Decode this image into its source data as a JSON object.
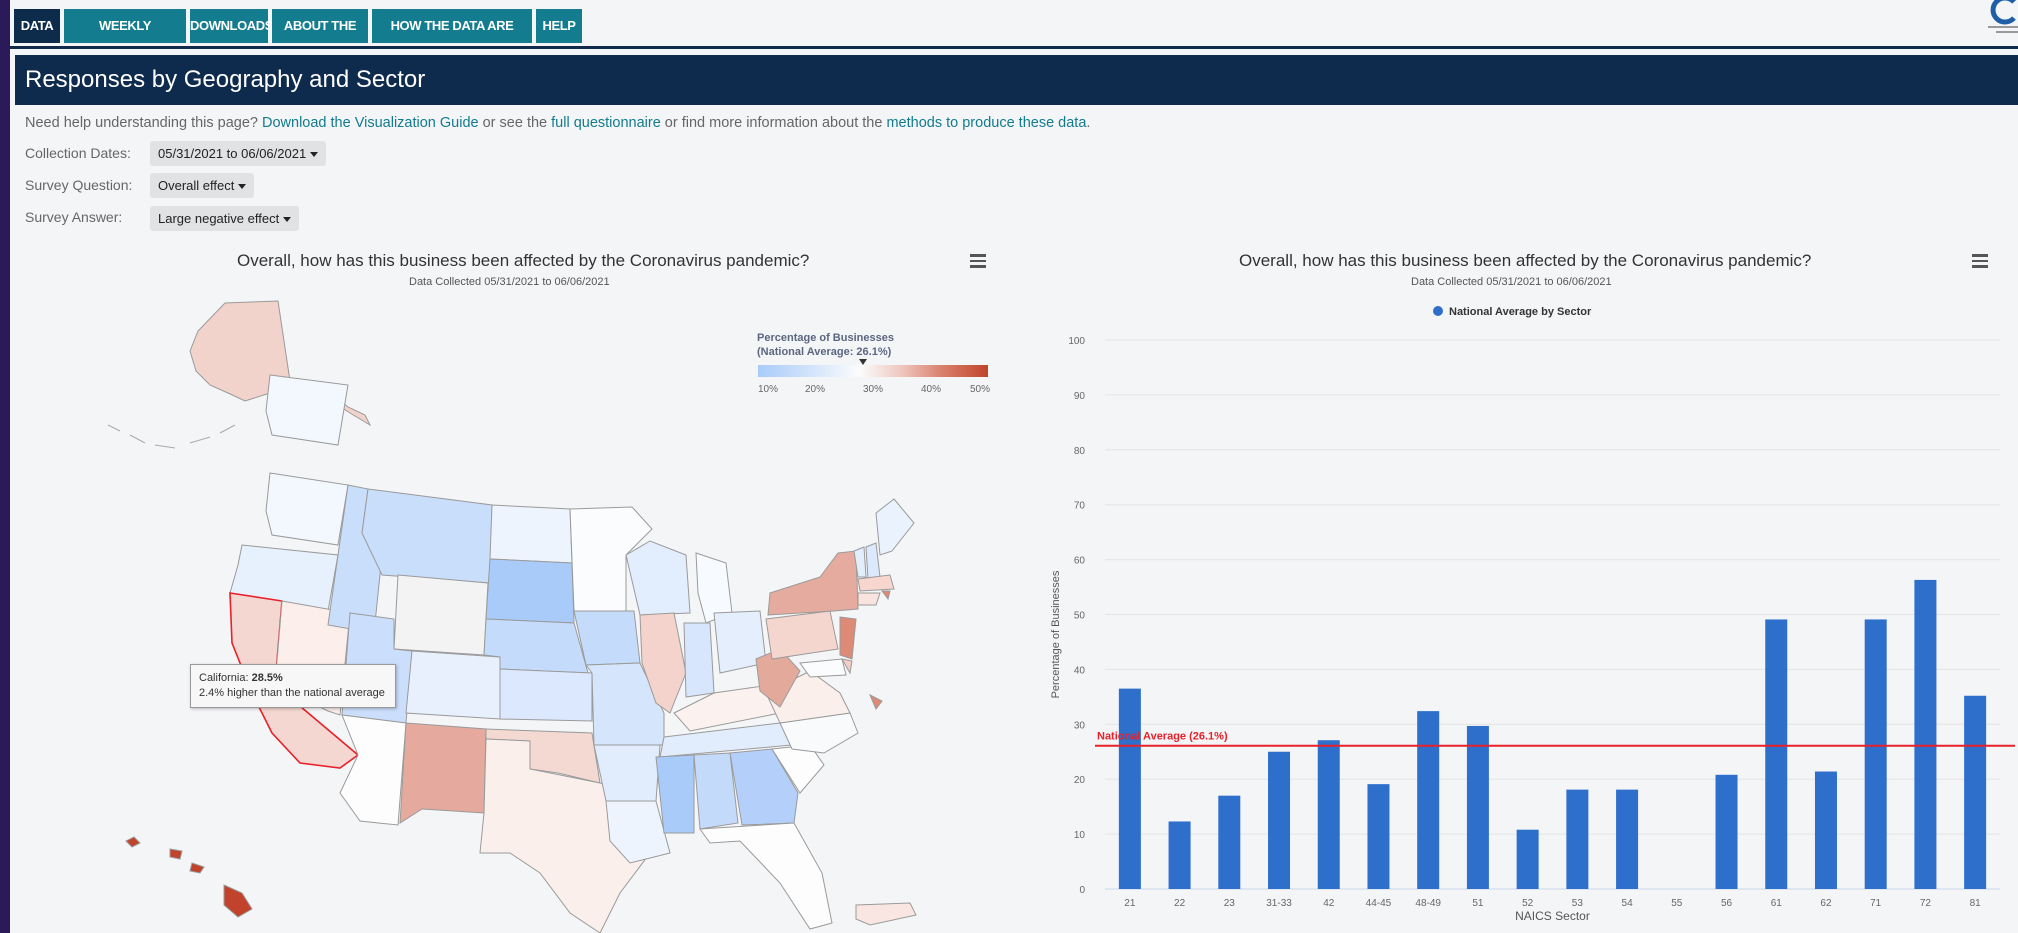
{
  "nav": {
    "tabs": [
      {
        "label": "DATA",
        "active": true
      },
      {
        "label": "WEEKLY COMPARISONS",
        "active": false
      },
      {
        "label": "DOWNLOADS",
        "active": false
      },
      {
        "label": "ABOUT THE DATA",
        "active": false
      },
      {
        "label": "HOW THE DATA ARE COLLECTED",
        "active": false
      },
      {
        "label": "HELP",
        "active": false
      }
    ]
  },
  "header": {
    "title": "Responses by Geography and Sector"
  },
  "help": {
    "t1": "Need help understanding this page? ",
    "l1": "Download the Visualization Guide",
    "t2": " or see the ",
    "l2": "full questionnaire",
    "t3": " or find more information about the ",
    "l3": "methods to produce these data",
    "t4": "."
  },
  "filters": {
    "dates_label": "Collection Dates:",
    "dates_value": "05/31/2021 to 06/06/2021",
    "question_label": "Survey Question:",
    "question_value": "Overall effect",
    "answer_label": "Survey Answer:",
    "answer_value": "Large negative effect"
  },
  "map_chart": {
    "title": "Overall, how has this business been affected by the Coronavirus pandemic?",
    "subtitle": "Data Collected 05/31/2021 to 06/06/2021",
    "legend_title": "Percentage of Businesses",
    "legend_subtitle": "(National Average: 26.1%)",
    "legend_ticks": [
      "10%",
      "20%",
      "30%",
      "40%",
      "50%"
    ],
    "tooltip": {
      "state": "California: ",
      "value": "28.5%",
      "note": "2.4% higher than the national average"
    },
    "colors": {
      "low": "#a9cbfa",
      "mid": "#fbfcfd",
      "high": "#c1432b",
      "highlight": "#e8212a"
    }
  },
  "chart_data": {
    "type": "bar",
    "title": "Overall, how has this business been affected by the Coronavirus pandemic?",
    "subtitle": "Data Collected 05/31/2021 to 06/06/2021",
    "xlabel": "NAICS Sector",
    "ylabel": "Percentage of Businesses",
    "ylim": [
      0,
      100
    ],
    "yticks": [
      0,
      10,
      20,
      30,
      40,
      50,
      60,
      70,
      80,
      90,
      100
    ],
    "grid": true,
    "legend_position": "top-center",
    "categories": [
      "21",
      "22",
      "23",
      "31-33",
      "42",
      "44-45",
      "48-49",
      "51",
      "52",
      "53",
      "54",
      "55",
      "56",
      "61",
      "62",
      "71",
      "72",
      "81"
    ],
    "series": [
      {
        "name": "National Average by Sector",
        "color": "#2e6fcc",
        "values": [
          36.5,
          12.3,
          17.0,
          25.0,
          27.1,
          19.1,
          32.4,
          29.7,
          10.8,
          18.1,
          18.1,
          0,
          20.8,
          49.1,
          21.4,
          49.1,
          56.3,
          35.2
        ]
      }
    ],
    "reference_line": {
      "label": "National Average (26.1%)",
      "value": 26.1,
      "color": "#e8212a"
    }
  }
}
